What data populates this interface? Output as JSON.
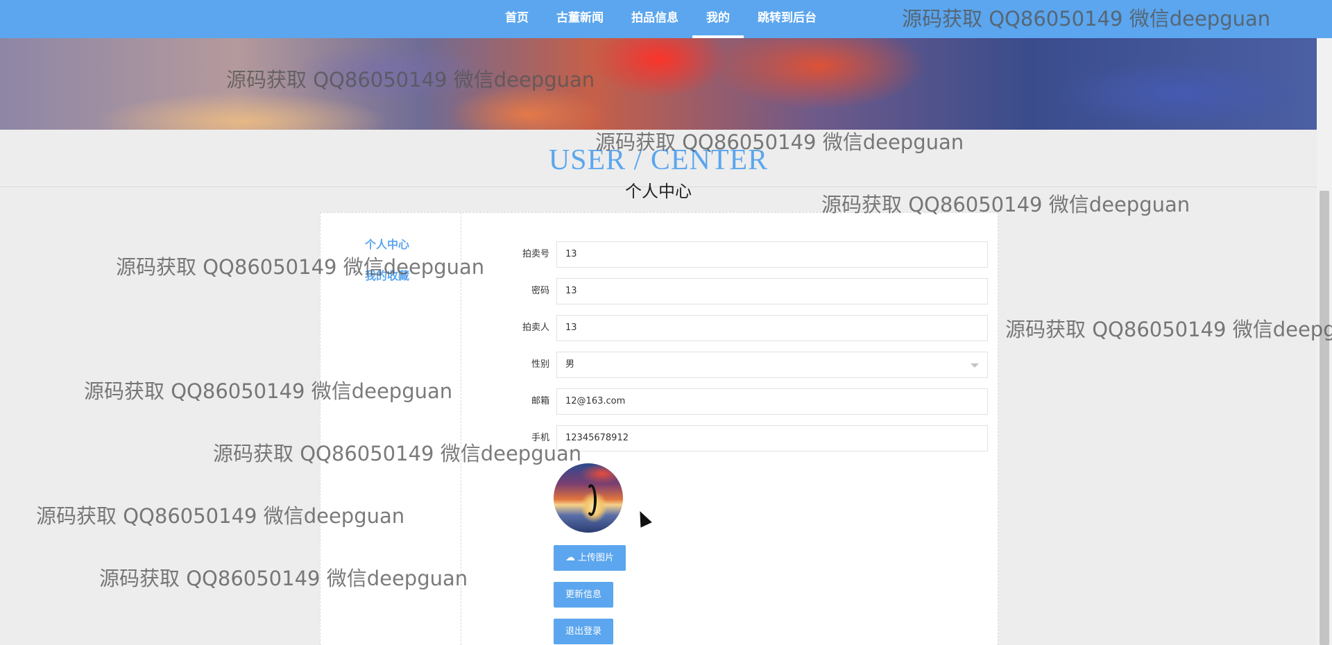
{
  "nav": {
    "items": [
      {
        "label": "首页",
        "active": false
      },
      {
        "label": "古董新闻",
        "active": false
      },
      {
        "label": "拍品信息",
        "active": false
      },
      {
        "label": "我的",
        "active": true
      },
      {
        "label": "跳转到后台",
        "active": false
      }
    ]
  },
  "heading": {
    "en": "USER / CENTER",
    "cn": "个人中心"
  },
  "sidebar": {
    "items": [
      {
        "label": "个人中心"
      },
      {
        "label": "我的收藏"
      }
    ]
  },
  "form": {
    "fields": [
      {
        "label": "拍卖号",
        "value": "13"
      },
      {
        "label": "密码",
        "value": "13"
      },
      {
        "label": "拍卖人",
        "value": "13"
      },
      {
        "label": "性别",
        "value": "男"
      },
      {
        "label": "邮箱",
        "value": "12@163.com"
      },
      {
        "label": "手机",
        "value": "12345678912"
      }
    ]
  },
  "buttons": {
    "upload": "上传图片",
    "update": "更新信息",
    "logout": "退出登录"
  },
  "watermark": {
    "text": "源码获取 QQ86050149 微信deepguan"
  },
  "colors": {
    "accent": "#5ba6ee",
    "background": "#ededed"
  }
}
